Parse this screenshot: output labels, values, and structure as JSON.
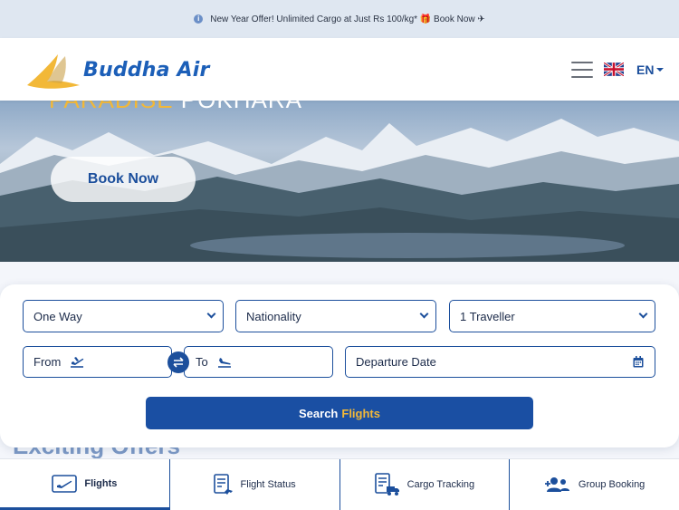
{
  "announcement": {
    "text": "New Year Offer! Unlimited Cargo at Just Rs 100/kg* 🎁 Book Now ✈"
  },
  "header": {
    "logo_text": "Buddha Air",
    "language": "EN"
  },
  "hero": {
    "title_accent": "PARADISE",
    "title_main": "POKHARA",
    "book_now_label": "Book Now"
  },
  "search": {
    "trip_type": "One Way",
    "nationality": "Nationality",
    "travellers": "1 Traveller",
    "from_label": "From",
    "to_label": "To",
    "departure_label": "Departure Date",
    "button_prefix": "Search",
    "button_accent": "Flights"
  },
  "offers_heading": "Exciting Offers",
  "bottom_nav": [
    {
      "label": "Flights",
      "icon": "plane-ticket-icon",
      "active": true
    },
    {
      "label": "Flight Status",
      "icon": "flight-status-icon",
      "active": false
    },
    {
      "label": "Cargo Tracking",
      "icon": "cargo-tracking-icon",
      "active": false
    },
    {
      "label": "Group Booking",
      "icon": "group-booking-icon",
      "active": false
    }
  ],
  "colors": {
    "brand_blue": "#1c4f9c",
    "accent_yellow": "#f2b838",
    "announce_bg": "#dfe7f1"
  }
}
